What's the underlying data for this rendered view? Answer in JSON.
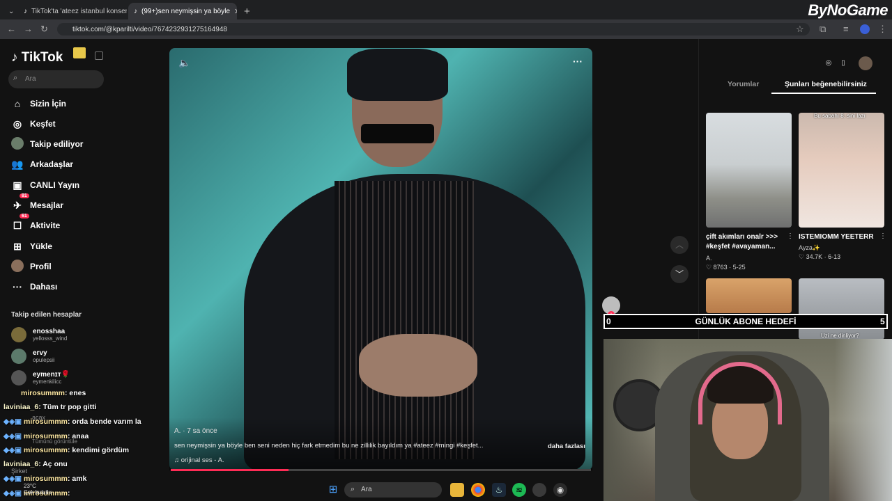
{
  "browser": {
    "tabs": [
      {
        "label": "TikTok'ta 'ateez istanbul konser"
      },
      {
        "label": "(99+)sen neymişsin ya böyle"
      }
    ],
    "url": "tiktok.com/@kparilti/video/7674232931275164948"
  },
  "brand_overlay": "ByNoGame",
  "tiktok": {
    "logo": "TikTok",
    "search_placeholder": "Ara",
    "nav": [
      {
        "label": "Sizin İçin",
        "icon": "home-icon"
      },
      {
        "label": "Keşfet",
        "icon": "compass-icon"
      },
      {
        "label": "Takip ediliyor",
        "icon": "following-icon"
      },
      {
        "label": "Arkadaşlar",
        "icon": "friends-icon"
      },
      {
        "label": "CANLI Yayın",
        "icon": "live-icon"
      },
      {
        "label": "Mesajlar",
        "icon": "message-icon",
        "badge": "81"
      },
      {
        "label": "Aktivite",
        "icon": "activity-icon",
        "badge": "61"
      },
      {
        "label": "Yükle",
        "icon": "upload-icon"
      },
      {
        "label": "Profil",
        "icon": "profile-icon"
      },
      {
        "label": "Dahası",
        "icon": "more-icon"
      }
    ],
    "following_header": "Takip edilen hesaplar",
    "following": [
      {
        "name": "enosshaa",
        "user": "yellosss_wind"
      },
      {
        "name": "ervy",
        "user": "opulepsii"
      },
      {
        "name": "eymenɪᴛ🌹",
        "user": "eymenkilicc"
      }
    ],
    "video": {
      "author": "A. · 7 sa önce",
      "caption": "sen neymişsin ya böyle ben seni neden hiç fark etmedim bu ne zillilik bayıldım ya #ateez #mingi #keşfet...",
      "more": "daha fazlası",
      "sound": "orijinal ses - A.",
      "progress": 0.28
    },
    "right_tabs": [
      "Yorumlar",
      "Şunları beğenebilirsiniz"
    ],
    "cards": [
      {
        "title": "çift akımları onalr >>> #keşfet #avayaman...",
        "author": "A.",
        "likes": "8763",
        "date": "5-25"
      },
      {
        "title": "ISTEMIOMM YEETERR",
        "author": "Ayza✨",
        "likes": "34.7K",
        "date": "6-13",
        "overlay": "Bu sabahı 8. sini lazı"
      },
      {
        "title": "",
        "author": "",
        "likes": "",
        "date": ""
      },
      {
        "title": "",
        "author": "",
        "likes": "",
        "date": "",
        "overlay": "Uzi ne dinliyor?"
      }
    ]
  },
  "goal": {
    "label": "GÜNLÜK ABONE HEDEFİ",
    "current": "0",
    "target": "5"
  },
  "chat": [
    {
      "user": "mirosummm",
      "msg": ": enes"
    },
    {
      "user": "laviniaa_6",
      "msg": ": Tüm tr pop gitti"
    },
    {
      "user": "mirosummm",
      "msg": ": orda bende varım la"
    },
    {
      "user": "mirosummm",
      "msg": ": anaa"
    },
    {
      "user": "mirosummm",
      "msg": ": kendimi gördüm"
    },
    {
      "user": "laviniaa_6",
      "msg": ": Aç onu"
    },
    {
      "user": "mirosummm",
      "msg": ": amk"
    },
    {
      "user": "mirosummm",
      "msg": ":"
    }
  ],
  "sidebar_faded": [
    "acax",
    "Tümünü görüntüle",
    "Şirket"
  ],
  "taskbar": {
    "search": "Ara",
    "weather_temp": "23°C",
    "weather_text": "Çok bulutlu"
  }
}
